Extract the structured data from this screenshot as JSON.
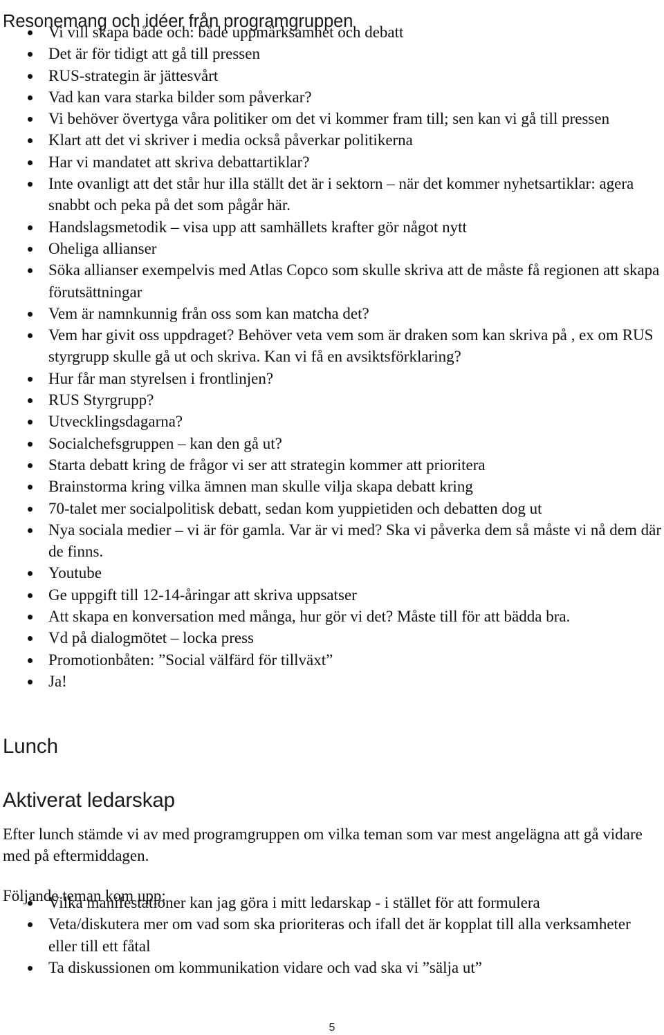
{
  "document": {
    "language": "sv",
    "page_number": "5",
    "heading_main": "Resonemang och idéer från programgruppen",
    "heading_lunch": "Lunch",
    "heading_aktiverat": "Aktiverat ledarskap",
    "paragraph_efter_lunch": "Efter lunch stämde vi av med programgruppen om vilka teman som var mest angelägna att gå vidare med på eftermiddagen.",
    "paragraph_foljande": "Följande teman kom upp:"
  },
  "list_intro": {
    "items": [
      "Vi vill skapa både och: både uppmärksamhet och debatt",
      "Det är för tidigt att gå till pressen",
      "RUS-strategin är jättesvårt",
      "Vad kan vara starka bilder som påverkar?",
      "Vi behöver övertyga våra politiker om det vi kommer fram till; sen kan vi gå till pressen",
      "Klart att det vi skriver i media också påverkar politikerna",
      "Har vi mandatet att skriva debattartiklar?",
      "Inte ovanligt att det står hur illa ställt det är i sektorn – när det kommer nyhetsartiklar: agera snabbt och peka på det som pågår här.",
      "Handslagsmetodik – visa upp att samhällets krafter gör något nytt",
      "Oheliga allianser",
      "Söka allianser exempelvis med Atlas Copco som skulle skriva att de måste få regionen att skapa förutsättningar",
      "Vem är namnkunnig från oss som kan matcha det?",
      "Vem har givit oss uppdraget? Behöver veta vem som är draken som kan skriva på , ex om RUS styrgrupp skulle gå ut och skriva. Kan vi få en avsiktsförklaring?",
      "Hur får man styrelsen i frontlinjen?",
      "RUS Styrgrupp?",
      "Utvecklingsdagarna?",
      "Socialchefsgruppen – kan den gå ut?",
      "Starta debatt kring de frågor vi ser att strategin kommer att prioritera",
      "Brainstorma kring vilka ämnen man skulle vilja skapa debatt kring",
      "70-talet mer socialpolitisk debatt, sedan kom yuppietiden och debatten dog ut",
      "Nya sociala medier – vi är för gamla. Var är vi med? Ska vi påverka dem så måste vi nå dem där de finns.",
      "Youtube",
      "Ge uppgift till 12-14-åringar att skriva uppsatser",
      "Att skapa en konversation med många, hur gör vi det? Måste till för att bädda bra.",
      "Vd på dialogmötet – locka press",
      "Promotionbåten: ”Social välfärd för tillväxt”",
      "Ja!"
    ]
  },
  "list_teman": {
    "items": [
      "Vilka manifestationer kan jag göra i mitt ledarskap - i stället för att formulera",
      "Veta/diskutera mer om vad som ska prioriteras och ifall det är kopplat till alla verksamheter eller till ett fåtal",
      "Ta diskussionen om kommunikation vidare och vad ska vi ”sälja ut”"
    ]
  }
}
